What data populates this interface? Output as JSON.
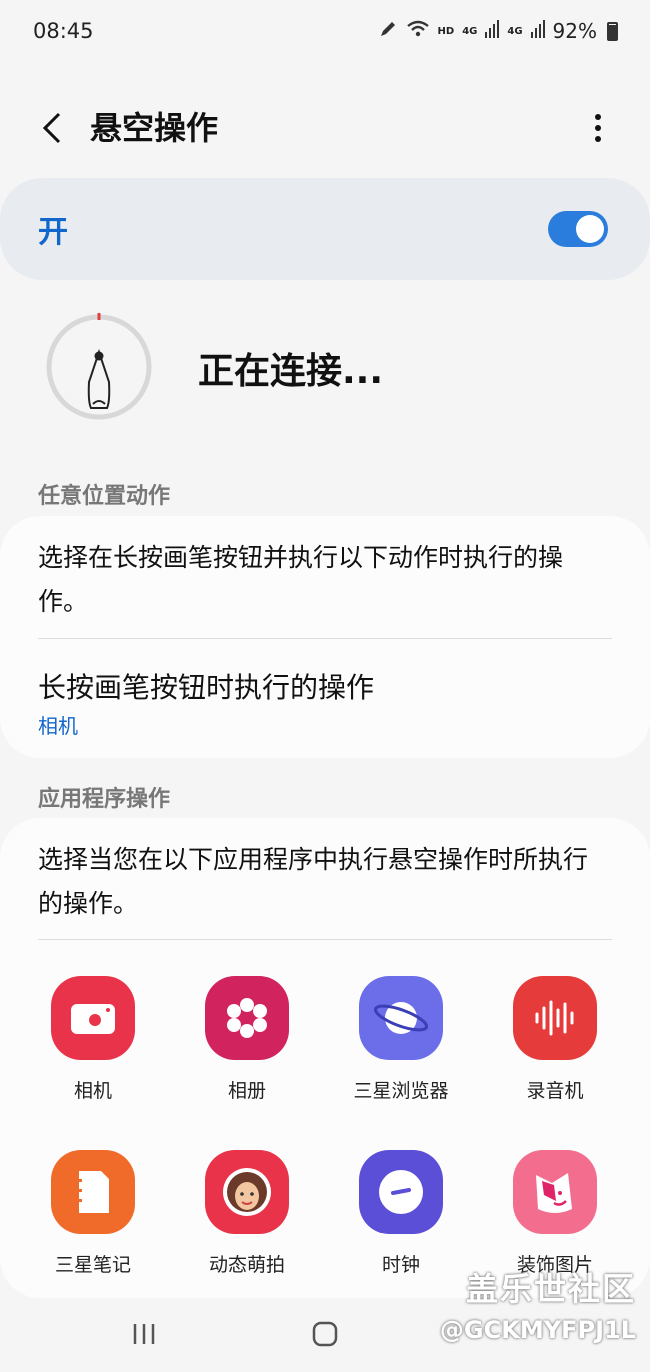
{
  "status_bar": {
    "time": "08:45",
    "network": "HD",
    "signal1": "4G",
    "signal2": "4G",
    "battery": "92%"
  },
  "header": {
    "title": "悬空操作"
  },
  "master_switch": {
    "label": "开",
    "state": "on",
    "accent": "#2a7ddc"
  },
  "pen": {
    "status_text": "正在连接..."
  },
  "anywhere_section": {
    "header": "任意位置动作",
    "description": "选择在长按画笔按钮并执行以下动作时执行的操作。",
    "item_title": "长按画笔按钮时执行的操作",
    "item_value": "相机"
  },
  "app_section": {
    "header": "应用程序操作",
    "description": "选择当您在以下应用程序中执行悬空操作时所执行的操作。",
    "apps": [
      {
        "label": "相机",
        "icon": "camera-icon",
        "color": "#e8334a"
      },
      {
        "label": "相册",
        "icon": "gallery-flower-icon",
        "color": "#d1235e"
      },
      {
        "label": "三星浏览器",
        "icon": "browser-planet-icon",
        "color": "#6b6ee8"
      },
      {
        "label": "录音机",
        "icon": "voice-wave-icon",
        "color": "#e53b3b"
      },
      {
        "label": "三星笔记",
        "icon": "notes-icon",
        "color": "#f06a2a"
      },
      {
        "label": "动态萌拍",
        "icon": "ar-emoji-icon",
        "color": "#e8334a"
      },
      {
        "label": "时钟",
        "icon": "clock-icon",
        "color": "#5a4fd6"
      },
      {
        "label": "装饰图片",
        "icon": "pen-up-icon",
        "color": "#f36d8f"
      }
    ]
  },
  "watermark": {
    "line1": "盖乐世社区",
    "line2": "@GCKMYFPJ1L"
  }
}
